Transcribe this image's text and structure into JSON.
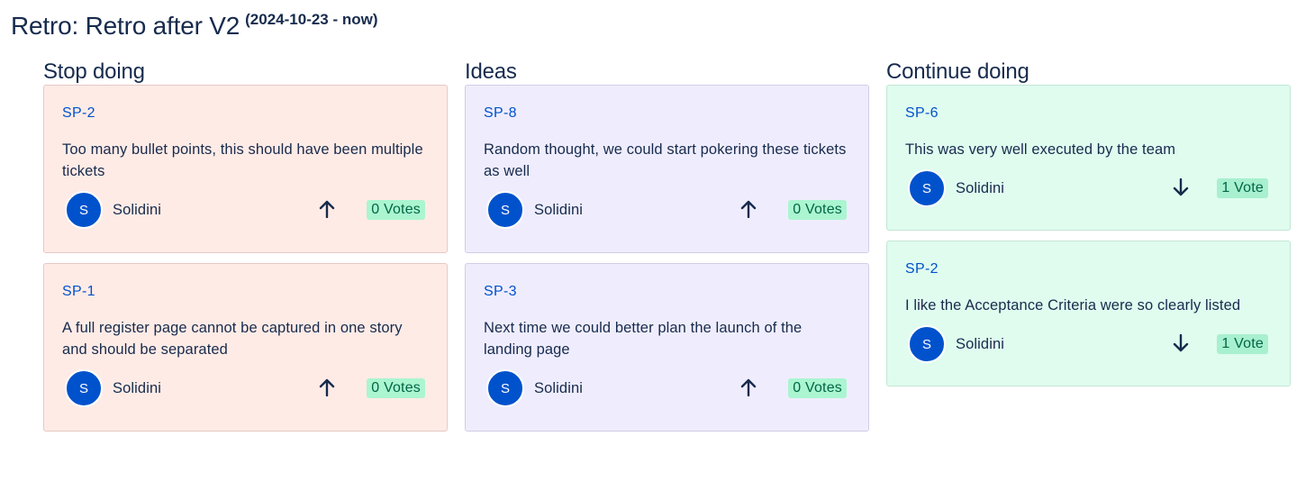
{
  "header": {
    "title": "Retro: Retro after V2",
    "dates": "(2024-10-23 - now)"
  },
  "columns": [
    {
      "title": "Stop doing",
      "color": "#ffebe6",
      "cards": [
        {
          "key": "SP-2",
          "text": "Too many bullet points, this should have been multiple tickets",
          "avatar": "S",
          "author": "Solidini",
          "vote_icon": "arrow-up-icon",
          "votes": "0 Votes"
        },
        {
          "key": "SP-1",
          "text": "A full register page cannot be captured in one story and should be separated",
          "avatar": "S",
          "author": "Solidini",
          "vote_icon": "arrow-up-icon",
          "votes": "0 Votes"
        }
      ]
    },
    {
      "title": "Ideas",
      "color": "#efedfd",
      "cards": [
        {
          "key": "SP-8",
          "text": "Random thought, we could start pokering these tickets as well",
          "avatar": "S",
          "author": "Solidini",
          "vote_icon": "arrow-up-icon",
          "votes": "0 Votes"
        },
        {
          "key": "SP-3",
          "text": "Next time we could better plan the launch of the landing page",
          "avatar": "S",
          "author": "Solidini",
          "vote_icon": "arrow-up-icon",
          "votes": "0 Votes"
        }
      ]
    },
    {
      "title": "Continue doing",
      "color": "#dffcef",
      "cards": [
        {
          "key": "SP-6",
          "text": "This was very well executed by the team",
          "avatar": "S",
          "author": "Solidini",
          "vote_icon": "arrow-down-icon",
          "votes": "1 Vote"
        },
        {
          "key": "SP-2",
          "text": "I like the Acceptance Criteria were so clearly listed",
          "avatar": "S",
          "author": "Solidini",
          "vote_icon": "arrow-down-icon",
          "votes": "1 Vote"
        }
      ]
    }
  ]
}
